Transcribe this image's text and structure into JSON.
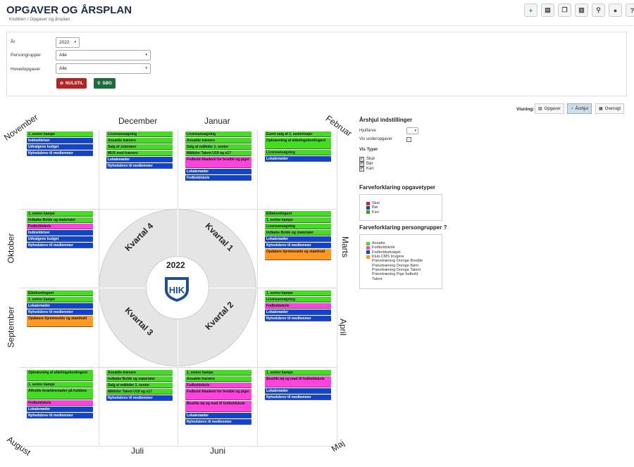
{
  "header": {
    "title": "OPGAVER OG ÅRSPLAN",
    "breadcrumb": "Klubben / Opgaver og årsplan"
  },
  "toolbar": [
    {
      "name": "add-icon",
      "glyph": "+"
    },
    {
      "name": "document-icon",
      "glyph": "▤"
    },
    {
      "name": "copy-icon",
      "glyph": "❐"
    },
    {
      "name": "pdf-icon",
      "glyph": "▥"
    },
    {
      "name": "zoom-icon",
      "glyph": "⚲"
    },
    {
      "name": "globe-icon",
      "glyph": "●"
    },
    {
      "name": "help-icon",
      "glyph": "?"
    }
  ],
  "filters": {
    "year_label": "År",
    "year_value": "2022",
    "persongrupper_label": "Persongrupper",
    "persongrupper_value": "Alle",
    "hovedopgaver_label": "Hovedopgaver",
    "hovedopgaver_value": "Alle",
    "reset_label": "NULSTIL",
    "search_label": "SØG"
  },
  "view": {
    "label": "Visning:",
    "opgaver": "Opgaver",
    "aarshjul": "Årshjul",
    "oversigt": "Oversigt"
  },
  "wheel": {
    "year": "2022",
    "q1": "Kvartal 1",
    "q2": "Kvartal 2",
    "q3": "Kvartal 3",
    "q4": "Kvartal 4"
  },
  "months": {
    "november": "November",
    "december": "December",
    "januar": "Januar",
    "februar": "Februar",
    "marts": "Marts",
    "april": "April",
    "maj": "Maj",
    "juni": "Juni",
    "juli": "Juli",
    "august": "August",
    "september": "September",
    "oktober": "Oktober"
  },
  "cells": {
    "nov": [
      {
        "c": "g",
        "t": "1. senior kampe"
      },
      {
        "c": "b",
        "t": "Indmeldelser"
      },
      {
        "c": "b",
        "t": "Udvalgene budget"
      },
      {
        "c": "b",
        "t": "Nyhedsbrev til medlemmer"
      }
    ],
    "dec": [
      {
        "c": "g",
        "t": "Licensansøgning"
      },
      {
        "c": "g",
        "t": "Ansætte trænere"
      },
      {
        "c": "g",
        "t": "Salg af Juletræer"
      },
      {
        "c": "g",
        "t": "MUS med trænere"
      },
      {
        "c": "b",
        "t": "Lokalemøder"
      },
      {
        "c": "b",
        "t": "Nyhedsbrev til medlemmer"
      }
    ],
    "jan": [
      {
        "c": "g",
        "t": "Licensansøgning"
      },
      {
        "c": "g",
        "t": "Ansætte trænere"
      },
      {
        "c": "g",
        "t": "Salg af måltider 1. senior"
      },
      {
        "c": "g",
        "t": "Måltider Talent U19 og u17"
      },
      {
        "c": "m",
        "t": "Fodbold Akademi for bredde og piger",
        "h": 1
      },
      {
        "c": "b",
        "t": "Lokalemøder"
      },
      {
        "c": "b",
        "t": "Fodboldskole"
      }
    ],
    "feb": [
      {
        "c": "g",
        "t": "Event salg af 1. seniortrøjer"
      },
      {
        "c": "g",
        "t": "Opkrævning af afdelingskontingent",
        "h": 1
      },
      {
        "c": "g",
        "t": "Licensansøgning"
      },
      {
        "c": "b",
        "t": "Lokalemøder"
      }
    ],
    "okt": [
      {
        "c": "g",
        "t": "1. senior kampe"
      },
      {
        "c": "g",
        "t": "Indkøbe Bolde og materialer"
      },
      {
        "c": "m",
        "t": "Fodboldskole"
      },
      {
        "c": "b",
        "t": "Indmeldelser"
      },
      {
        "c": "b",
        "t": "Udvalgene budget"
      },
      {
        "c": "b",
        "t": "Nyhedsbrev til medlemmer"
      }
    ],
    "mar": [
      {
        "c": "g",
        "t": "Elitekontingent"
      },
      {
        "c": "g",
        "t": "1. senior kampe"
      },
      {
        "c": "g",
        "t": "Licensansøgning"
      },
      {
        "c": "g",
        "t": "Indkøbe Bolde og materialer"
      },
      {
        "c": "b",
        "t": "Lokalemøder"
      },
      {
        "c": "b",
        "t": "Nyhedsbrev til medlemmer"
      },
      {
        "c": "o",
        "t": "Opdatere hjemmeside og stamhold",
        "h": 1
      }
    ],
    "sep": [
      {
        "c": "g",
        "t": "Elitekontingent"
      },
      {
        "c": "g",
        "t": "1. senior kampe"
      },
      {
        "c": "b",
        "t": "Lokalemøder"
      },
      {
        "c": "b",
        "t": "Nyhedsbrev til medlemmer"
      },
      {
        "c": "o",
        "t": "Opdatere hjemmeside og stamhold",
        "h": 1
      }
    ],
    "apr": [
      {
        "c": "g",
        "t": "1. senior kampe"
      },
      {
        "c": "g",
        "t": "Licensansøgning"
      },
      {
        "c": "m",
        "t": "Fodboldskole"
      },
      {
        "c": "b",
        "t": "Lokalemøder"
      },
      {
        "c": "b",
        "t": "Nyhedsbrev til medlemmer"
      }
    ],
    "aug": [
      {
        "c": "g",
        "t": "Opkrævning af afdelingskontingent",
        "h": 1
      },
      {
        "c": "g",
        "t": "1. senior kampe"
      },
      {
        "c": "g",
        "t": "Afholde forældremøder på holdene",
        "h": 1
      },
      {
        "c": "m",
        "t": "Fodboldskole"
      },
      {
        "c": "b",
        "t": "Lokalemøder"
      },
      {
        "c": "b",
        "t": "Nyhedsbrev til medlemmer"
      }
    ],
    "jul": [
      {
        "c": "g",
        "t": "Ansætte trænere"
      },
      {
        "c": "g",
        "t": "Indkøbe Bolde og materialer"
      },
      {
        "c": "g",
        "t": "Salg af måltider 1. senior"
      },
      {
        "c": "g",
        "t": "Måltider Talent U19 og u17"
      },
      {
        "c": "b",
        "t": "Nyhedsbrev til medlemmer"
      }
    ],
    "jun": [
      {
        "c": "g",
        "t": "1. senior kampe"
      },
      {
        "c": "g",
        "t": "Ansætte trænere"
      },
      {
        "c": "m",
        "t": "Fodboldskole"
      },
      {
        "c": "m",
        "t": "Fodbold Akademi for bredde og piger",
        "h": 1
      },
      {
        "c": "m",
        "t": "Bestille tøj og mad til fodboldskole",
        "h": 1
      },
      {
        "c": "b",
        "t": "Lokalemøder"
      },
      {
        "c": "b",
        "t": "Nyhedsbrev til medlemmer"
      }
    ],
    "maj": [
      {
        "c": "g",
        "t": "1. senior kampe"
      },
      {
        "c": "m",
        "t": "Bestille tøj og mad til fodboldskole",
        "h": 1
      },
      {
        "c": "b",
        "t": "Lokalemøder"
      },
      {
        "c": "b",
        "t": "Nyhedsbrev til medlemmer"
      }
    ]
  },
  "settings": {
    "title": "Årshjul indstillinger",
    "hjulfarve": "Hjulfarve",
    "vis_under": "Vis underopgaver",
    "vis_typer": "Vis Typer",
    "skal": "Skal",
    "boer": "Bør",
    "kan": "Kan"
  },
  "legend_types": {
    "title": "Farveforklaring opgavetyper",
    "items": [
      {
        "label": "Skal",
        "color": "#e02020"
      },
      {
        "label": "Bør",
        "color": "#1144cc"
      },
      {
        "label": "Kan",
        "color": "#22aa22"
      }
    ]
  },
  "legend_groups": {
    "title": "Farveforklaring persongrupper ?",
    "items": [
      {
        "label": "Ansatte",
        "color": "#44dd22"
      },
      {
        "label": "Fodboldskole",
        "color": "#ff44dd"
      },
      {
        "label": "Fodboldudvalget",
        "color": "#1144cc"
      },
      {
        "label": "Klub-CMS brugere",
        "color": "#ff9922"
      },
      {
        "label": "Prøvetræning Drenge Bredde",
        "color": ""
      },
      {
        "label": "Prøvetræning Drenge Børn",
        "color": ""
      },
      {
        "label": "Prøvetræning Drenge Talent",
        "color": ""
      },
      {
        "label": "Prøvetræning Pige fodbold",
        "color": ""
      },
      {
        "label": "Talent",
        "color": ""
      }
    ]
  }
}
